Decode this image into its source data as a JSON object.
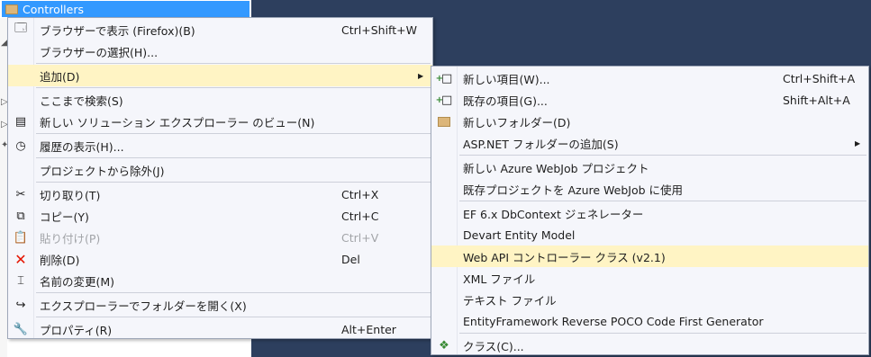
{
  "tree": {
    "selected_label": "Controllers"
  },
  "menu": {
    "items": [
      {
        "label": "ブラウザーで表示 (Firefox)(B)",
        "shortcut": "Ctrl+Shift+W"
      },
      {
        "label": "ブラウザーの選択(H)..."
      },
      {
        "label": "追加(D)"
      },
      {
        "label": "ここまで検索(S)"
      },
      {
        "label": "新しい ソリューション エクスプローラー のビュー(N)"
      },
      {
        "label": "履歴の表示(H)..."
      },
      {
        "label": "プロジェクトから除外(J)"
      },
      {
        "label": "切り取り(T)",
        "shortcut": "Ctrl+X"
      },
      {
        "label": "コピー(Y)",
        "shortcut": "Ctrl+C"
      },
      {
        "label": "貼り付け(P)",
        "shortcut": "Ctrl+V"
      },
      {
        "label": "削除(D)",
        "shortcut": "Del"
      },
      {
        "label": "名前の変更(M)"
      },
      {
        "label": "エクスプローラーでフォルダーを開く(X)"
      },
      {
        "label": "プロパティ(R)",
        "shortcut": "Alt+Enter"
      }
    ]
  },
  "submenu": {
    "items": [
      {
        "label": "新しい項目(W)...",
        "shortcut": "Ctrl+Shift+A"
      },
      {
        "label": "既存の項目(G)...",
        "shortcut": "Shift+Alt+A"
      },
      {
        "label": "新しいフォルダー(D)"
      },
      {
        "label": "ASP.NET フォルダーの追加(S)"
      },
      {
        "label": "新しい Azure WebJob プロジェクト"
      },
      {
        "label": "既存プロジェクトを Azure WebJob に使用"
      },
      {
        "label": "EF 6.x DbContext ジェネレーター"
      },
      {
        "label": "Devart Entity Model"
      },
      {
        "label": "Web API コントローラー クラス (v2.1)"
      },
      {
        "label": "XML ファイル"
      },
      {
        "label": "テキスト ファイル"
      },
      {
        "label": "EntityFramework Reverse POCO Code First Generator"
      },
      {
        "label": "クラス(C)..."
      }
    ]
  },
  "colors": {
    "highlight": "#fff4c4",
    "selection": "#3399ff",
    "background": "#2d3f5e"
  }
}
